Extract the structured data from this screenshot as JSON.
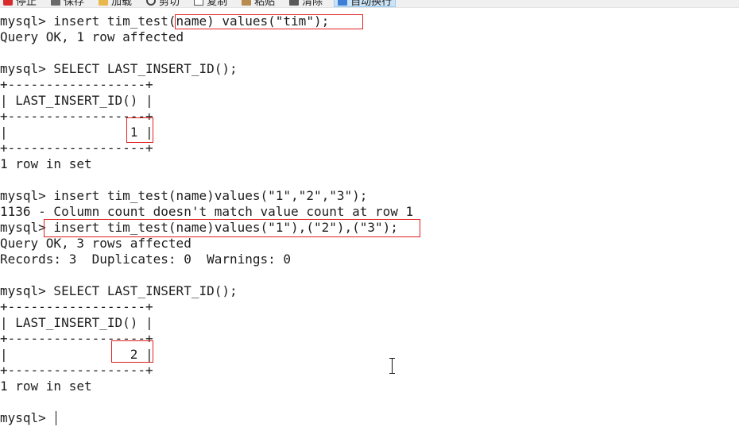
{
  "toolbar": {
    "buttons": [
      {
        "label": "停止",
        "icon": "stop-icon"
      },
      {
        "label": "保存",
        "icon": "save-icon"
      },
      {
        "label": "加载",
        "icon": "folder-icon"
      },
      {
        "label": "剪切",
        "icon": "scissors-icon"
      },
      {
        "label": "复制",
        "icon": "copy-icon"
      },
      {
        "label": "粘贴",
        "icon": "paste-icon"
      },
      {
        "label": "清除",
        "icon": "trash-icon"
      },
      {
        "label": "自动换行",
        "icon": "wrap-icon",
        "active": true
      }
    ]
  },
  "terminal": {
    "lines": [
      "mysql> insert tim_test(name) values(\"tim\");",
      "Query OK, 1 row affected",
      "",
      "mysql> SELECT LAST_INSERT_ID();",
      "+------------------+",
      "| LAST_INSERT_ID() |",
      "+------------------+",
      "|                1 |",
      "+------------------+",
      "1 row in set",
      "",
      "mysql> insert tim_test(name)values(\"1\",\"2\",\"3\");",
      "1136 - Column count doesn't match value count at row 1",
      "mysql> insert tim_test(name)values(\"1\"),(\"2\"),(\"3\");",
      "Query OK, 3 rows affected",
      "Records: 3  Duplicates: 0  Warnings: 0",
      "",
      "mysql> SELECT LAST_INSERT_ID();",
      "+------------------+",
      "| LAST_INSERT_ID() |",
      "+------------------+",
      "|                2 |",
      "+------------------+",
      "1 row in set",
      "",
      "mysql> "
    ]
  },
  "colors": {
    "text": "#1e1e1e",
    "highlight": "#e02020",
    "background": "#ffffff"
  }
}
